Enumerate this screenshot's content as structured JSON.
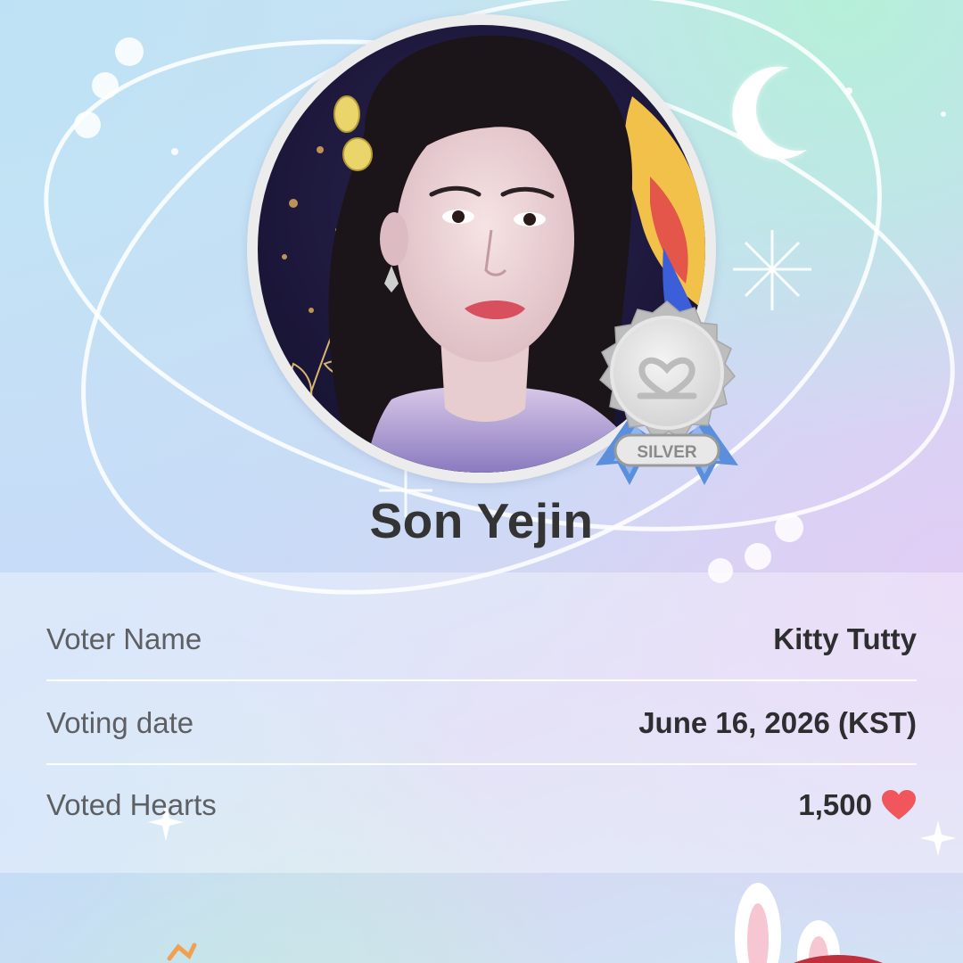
{
  "idol": {
    "name": "Son Yejin",
    "badge_label": "SILVER"
  },
  "details": {
    "voter_name_label": "Voter Name",
    "voter_name_value": "Kitty Tutty",
    "voting_date_label": "Voting date",
    "voting_date_value": "June 16, 2026 (KST)",
    "voted_hearts_label": "Voted Hearts",
    "voted_hearts_value": "1,500"
  },
  "icons": {
    "heart": "heart-icon",
    "medal": "silver-medal-icon",
    "moon": "crescent-moon-icon",
    "sparkle": "sparkle-icon"
  },
  "colors": {
    "heart": "#f0565b",
    "medal_silver": "#c9c9c9",
    "ribbon": "#5b8fdc",
    "name_text": "#343434"
  }
}
